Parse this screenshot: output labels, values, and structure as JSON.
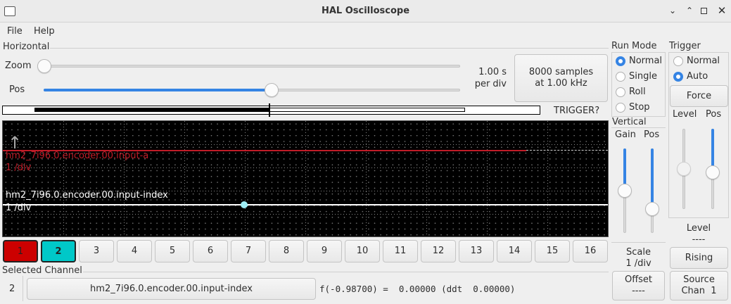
{
  "window": {
    "title": "HAL Oscilloscope"
  },
  "menu": {
    "file": "File",
    "help": "Help"
  },
  "horizontal": {
    "label": "Horizontal",
    "zoom_label": "Zoom",
    "pos_label": "Pos",
    "zoom_value": 0.0,
    "pos_value": 0.5,
    "time_per_div": "1.00 s",
    "per_div_label": "per div",
    "samples_line1": "8000 samples",
    "samples_line2": "at 1.00 kHz",
    "trigger_status": "TRIGGER?"
  },
  "run_mode": {
    "label": "Run Mode",
    "options": [
      "Normal",
      "Single",
      "Roll",
      "Stop"
    ],
    "selected": "Normal"
  },
  "trigger": {
    "label": "Trigger",
    "options": [
      "Normal",
      "Auto"
    ],
    "selected": "Auto",
    "force_label": "Force",
    "level_label": "Level",
    "pos_label": "Pos",
    "level_readout_label": "Level",
    "level_readout_value": "----",
    "edge_button": "Rising",
    "source_line1": "Source",
    "source_line2": "Chan  1"
  },
  "vertical": {
    "label": "Vertical",
    "gain_label": "Gain",
    "pos_label": "Pos",
    "scale_label": "Scale",
    "scale_value": "1 /div",
    "offset_label": "Offset",
    "offset_value": "----"
  },
  "scope": {
    "traces": [
      {
        "name": "hm2_7i96.0.encoder.00.input-a",
        "scale": "1 /div",
        "color": "#c01c28"
      },
      {
        "name": "hm2_7i96.0.encoder.00.input-index",
        "scale": "1 /div",
        "color": "#ffffff"
      }
    ]
  },
  "channels": {
    "buttons": [
      "1",
      "2",
      "3",
      "4",
      "5",
      "6",
      "7",
      "8",
      "9",
      "10",
      "11",
      "12",
      "13",
      "14",
      "15",
      "16"
    ],
    "ch1_color": "#cc0000",
    "ch2_color": "#00c8c8"
  },
  "selected_channel": {
    "label": "Selected Channel",
    "number": "2",
    "pin_name": "hm2_7i96.0.encoder.00.input-index",
    "readout": "f(-0.98700) =  0.00000 (ddt  0.00000)"
  }
}
